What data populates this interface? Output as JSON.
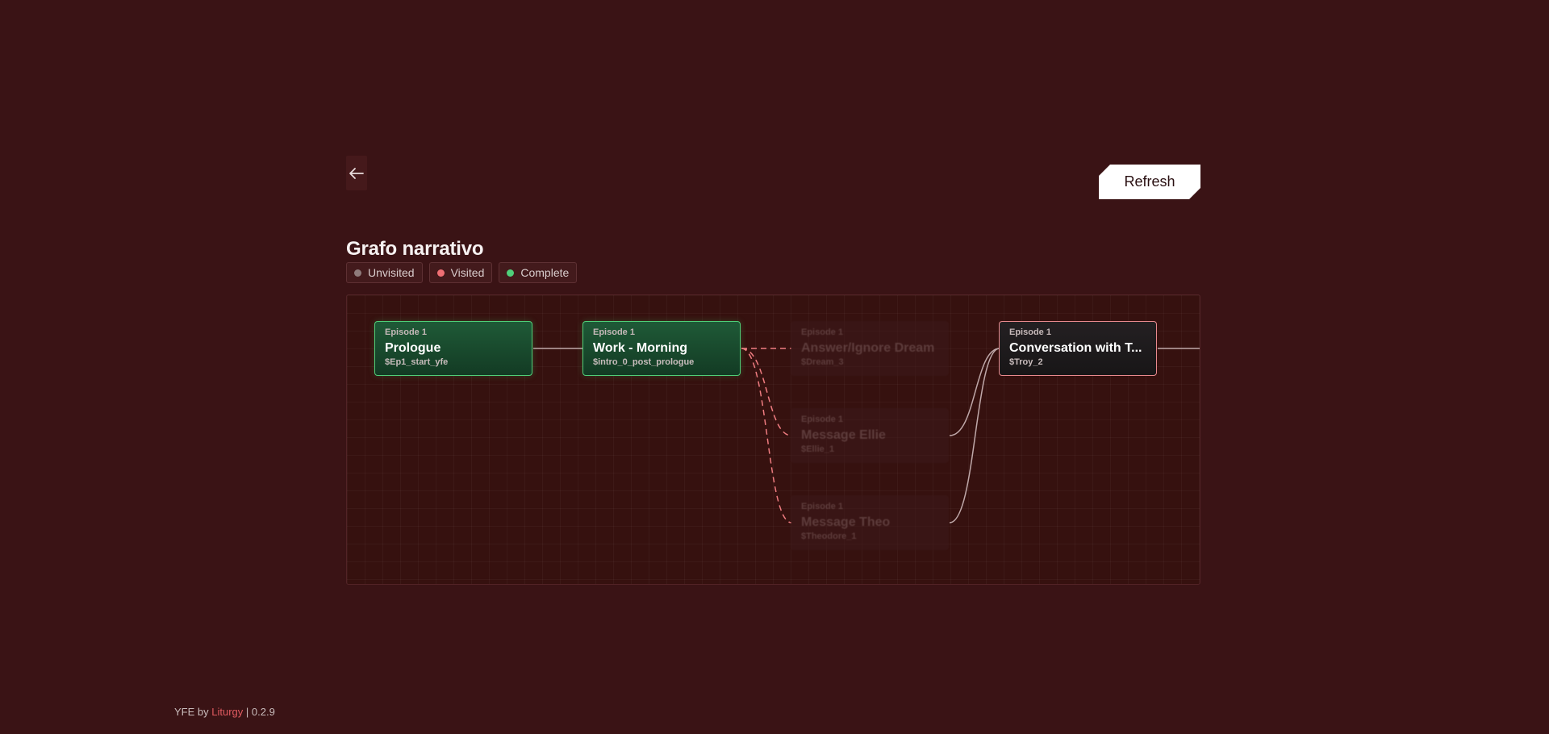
{
  "back_button": {
    "icon": "arrow-left-icon"
  },
  "refresh_button": {
    "label": "Refresh"
  },
  "page_title": "Grafo narrativo",
  "legend": [
    {
      "label": "Unvisited",
      "color": "#8f7b7b"
    },
    {
      "label": "Visited",
      "color": "#ef6f74"
    },
    {
      "label": "Complete",
      "color": "#4fd07a"
    }
  ],
  "graph": {
    "nodes": [
      {
        "episode": "Episode 1",
        "title": "Prologue",
        "var": "$Ep1_start_yfe",
        "status": "complete"
      },
      {
        "episode": "Episode 1",
        "title": "Work - Morning",
        "var": "$intro_0_post_prologue",
        "status": "complete"
      },
      {
        "episode": "Episode 1",
        "title": "Answer/Ignore Dream",
        "var": "$Dream_3",
        "status": "unvisited"
      },
      {
        "episode": "Episode 1",
        "title": "Message Ellie",
        "var": "$Ellie_1",
        "status": "unvisited"
      },
      {
        "episode": "Episode 1",
        "title": "Message Theo",
        "var": "$Theodore_1",
        "status": "unvisited"
      },
      {
        "episode": "Episode 1",
        "title": "Conversation with T...",
        "var": "$Troy_2",
        "status": "visited"
      }
    ],
    "colors": {
      "edge_solid": "#bfa8a9",
      "edge_dashed": "#ef7c80"
    }
  },
  "footer": {
    "prefix": "YFE by",
    "brand": "Liturgy",
    "version": "| 0.2.9"
  }
}
